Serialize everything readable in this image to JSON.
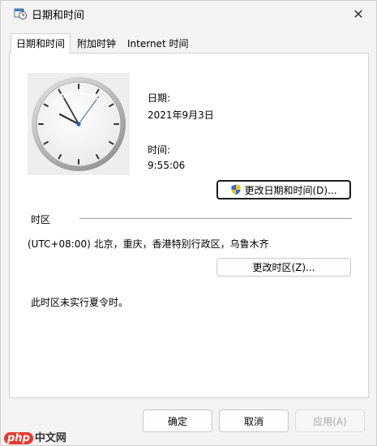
{
  "window": {
    "title": "日期和时间",
    "close_icon": "close-icon"
  },
  "tabs": [
    {
      "label": "日期和时间",
      "active": true
    },
    {
      "label": "附加时钟",
      "active": false
    },
    {
      "label": "Internet 时间",
      "active": false
    }
  ],
  "datetime": {
    "date_label": "日期:",
    "date_value": "2021年9月3日",
    "time_label": "时间:",
    "time_value": "9:55:06",
    "change_button": "更改日期和时间(D)..."
  },
  "timezone": {
    "section_label": "时区",
    "value": "(UTC+08:00) 北京，重庆，香港特别行政区，乌鲁木齐",
    "change_button": "更改时区(Z)...",
    "dst_note": "此时区未实行夏令时。"
  },
  "footer": {
    "ok_button": "确定",
    "cancel_button": "取消",
    "apply_button": "应用(A)"
  },
  "watermark": {
    "text_php": "php",
    "text_site": "中文网"
  },
  "colors": {
    "window_bg": "#f3f3f3",
    "panel_bg": "#ffffff",
    "shield_blue": "#2f6fd6",
    "shield_yellow": "#f2c31b"
  }
}
